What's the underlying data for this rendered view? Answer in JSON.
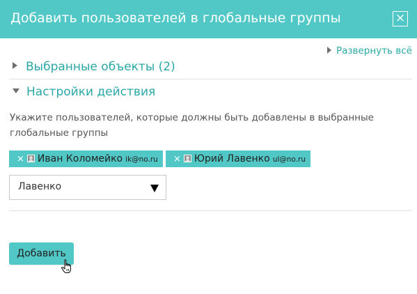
{
  "dialog": {
    "title": "Добавить пользователей в глобальные группы",
    "close_label": "×"
  },
  "expand_all_label": "Развернуть всё",
  "sections": {
    "selected_objects_label": "Выбранные объекты (2)",
    "action_settings_label": "Настройки действия"
  },
  "instructions": "Укажите пользователей, которые должны быть добавлены в выбранные глобальные группы",
  "selected_users": [
    {
      "remove_label": "×",
      "name": "Иван Коломейко",
      "email": "ik@no.ru"
    },
    {
      "remove_label": "×",
      "name": "Юрий Лавенко",
      "email": "ul@no.ru"
    }
  ],
  "search_select": {
    "value": "Лавенко"
  },
  "submit_label": "Добавить",
  "colors": {
    "accent": "#52c8c6",
    "link": "#2aa8a6",
    "divider": "#e1e1e1"
  },
  "icons": {
    "close": "close-icon",
    "expand": "triangle-right-icon",
    "collapse": "triangle-down-icon",
    "user": "user-icon",
    "remove": "remove-x-icon",
    "dropdown": "dropdown-arrow-icon",
    "cursor": "hand-cursor-icon"
  }
}
